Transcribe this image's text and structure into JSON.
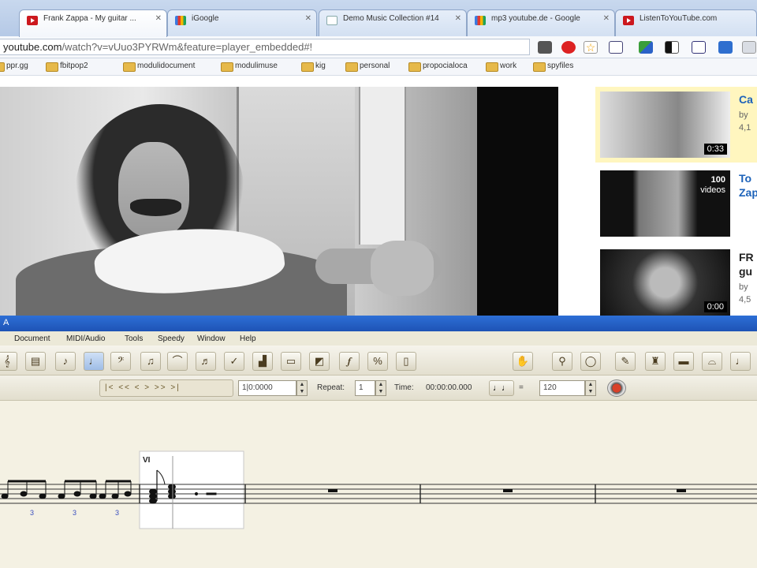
{
  "browser": {
    "tabs": [
      {
        "title": "Frank Zappa - My guitar ...",
        "icon": "youtube-icon",
        "active": true
      },
      {
        "title": "iGoogle",
        "icon": "google-icon",
        "active": false
      },
      {
        "title": "Demo Music Collection #14",
        "icon": "document-icon",
        "active": false
      },
      {
        "title": "mp3 youtube.de - Google",
        "icon": "google-icon",
        "active": false
      },
      {
        "title": "ListenToYouTube.com",
        "icon": "youtube-icon",
        "active": false
      }
    ],
    "url_domain": "youtube.com",
    "url_rest": "/watch?v=vUuo3PYRWm&feature=player_embedded#!",
    "bookmarks": [
      "ppr.gg",
      "fbitpop2",
      "modulidocument",
      "modulimuse",
      "kig",
      "personal",
      "propocialoca",
      "work",
      "spyfiles"
    ]
  },
  "youtube": {
    "related": [
      {
        "title": "Ca",
        "meta1": "by",
        "meta2": "4,1",
        "duration": "0:33",
        "highlighted": true
      },
      {
        "title": "To",
        "title2": "Zap",
        "count_num": "100",
        "count_label": "videos",
        "highlighted": false
      },
      {
        "title": "FR",
        "title2": "gu",
        "meta1": "by",
        "meta2": "4,5",
        "duration": "0:00",
        "highlighted": false
      }
    ]
  },
  "notation_app": {
    "title_icon": "A",
    "menus": [
      "Document",
      "MIDI/Audio",
      "Tools",
      "Speedy",
      "Window",
      "Help"
    ],
    "transport_label": "|< << < > >> >|",
    "position_value": "1|0:0000",
    "repeat_label": "Repeat:",
    "repeat_value": "1",
    "time_label": "Time:",
    "time_value": "00:00:00.000",
    "tempo_value": "120",
    "measure_label": "VI"
  }
}
